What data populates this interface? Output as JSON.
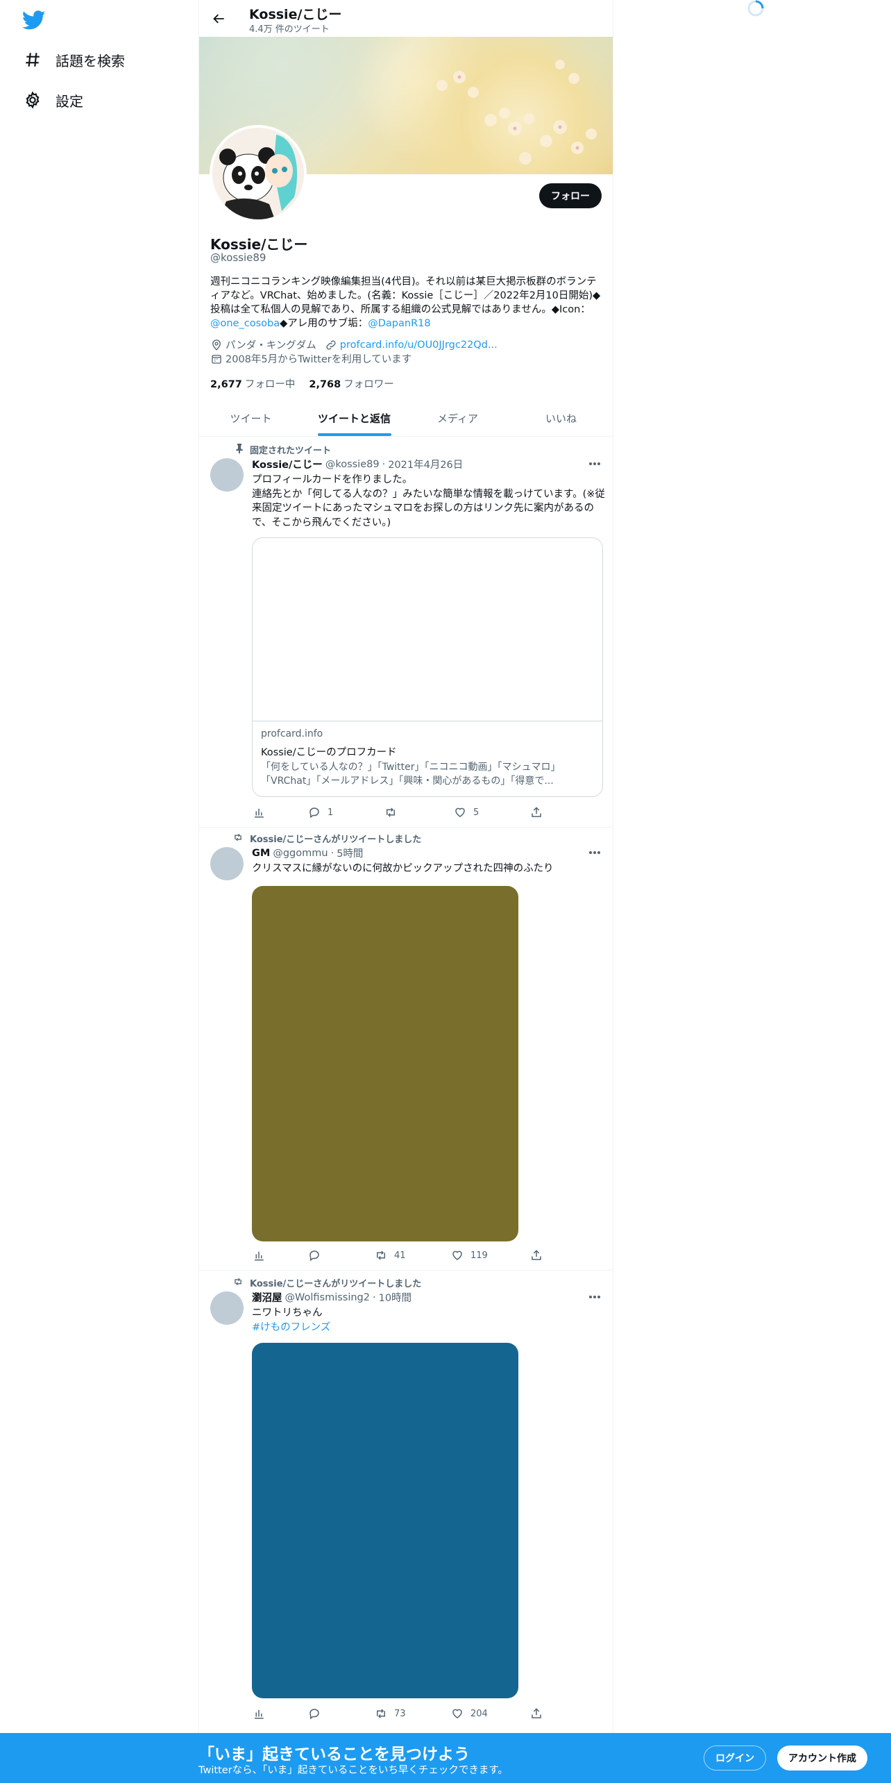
{
  "nav": {
    "logo": "twitter-bird-icon",
    "items": [
      {
        "icon": "hashtag-icon",
        "label": "話題を検索"
      },
      {
        "icon": "gear-icon",
        "label": "設定"
      }
    ]
  },
  "header": {
    "name": "Kossie/こじー",
    "tweet_count": "4.4万 件のツイート"
  },
  "profile": {
    "name": "Kossie/こじー",
    "handle": "@kossie89",
    "follow_label": "フォロー",
    "bio": {
      "line1": "週刊ニコニコランキング映像編集担当(4代目)。それ以前は某巨大掲示板群のボランティアなど。VRChat、始めました。(名義：Kossie［こじー］／2022年2月10日開始)◆投稿は全て私個人の見解であり、所属する組織の公式見解ではありません。◆Icon：",
      "mention1": "@one_cosoba",
      "line2": "◆アレ用のサブ垢：",
      "mention2": "@DapanR18"
    },
    "location": "パンダ・キングダム",
    "url": "profcard.info/u/OU0JJrgc22Qd...",
    "joined": "2008年5月からTwitterを利用しています",
    "following_count": "2,677",
    "following_label": "フォロー中",
    "followers_count": "2,768",
    "followers_label": "フォロワー"
  },
  "tabs": [
    {
      "label": "ツイート",
      "active": false
    },
    {
      "label": "ツイートと返信",
      "active": true
    },
    {
      "label": "メディア",
      "active": false
    },
    {
      "label": "いいね",
      "active": false
    }
  ],
  "tweets": [
    {
      "context": "固定されたツイート",
      "context_icon": "pin-icon",
      "name": "Kossie/こじー",
      "handle": "@kossie89",
      "time": "2021年4月26日",
      "text": [
        "プロフィールカードを作りました。",
        "連絡先とか「何してる人なの？」みたいな簡単な情報を載っけています。(※従来固定ツイートにあったマシュマロをお探しの方はリンク先に案内があるので、そこから飛んでください。)"
      ],
      "card": {
        "domain": "profcard.info",
        "title": "Kossie/こじーのプロフカード",
        "desc": "「何をしている人なの？」「Twitter」「ニコニコ動画」「マシュマロ」「VRChat」「メールアドレス」「興味・関心があるもの」「得意で..."
      },
      "replies": "1",
      "retweets": "",
      "likes": "5"
    },
    {
      "context": "Kossie/こじーさんがリツイートしました",
      "context_icon": "retweet-icon",
      "name": "GM",
      "handle": "@ggommu",
      "time": "5時間",
      "text": [
        "クリスマスに縁がないのに何故かピックアップされた四神のふたり"
      ],
      "media_color": "#7a6e2c",
      "replies": "",
      "retweets": "41",
      "likes": "119"
    },
    {
      "context": "Kossie/こじーさんがリツイートしました",
      "context_icon": "retweet-icon",
      "name": "瀏沼屋",
      "handle": "@Wolfismissing2",
      "time": "10時間",
      "text": [
        "ニワトリちゃん"
      ],
      "hashtag": "#けものフレンズ",
      "media_color": "#156591",
      "replies": "",
      "retweets": "73",
      "likes": "204"
    }
  ],
  "bottom_bar": {
    "title": "「いま」起きていることを見つけよう",
    "subtitle": "Twitterなら、「いま」起きていることをいち早くチェックできます。",
    "login_label": "ログイン",
    "signup_label": "アカウント作成"
  },
  "colors": {
    "accent": "#1d9bf0",
    "text": "#0f1419",
    "secondary": "#536471"
  }
}
